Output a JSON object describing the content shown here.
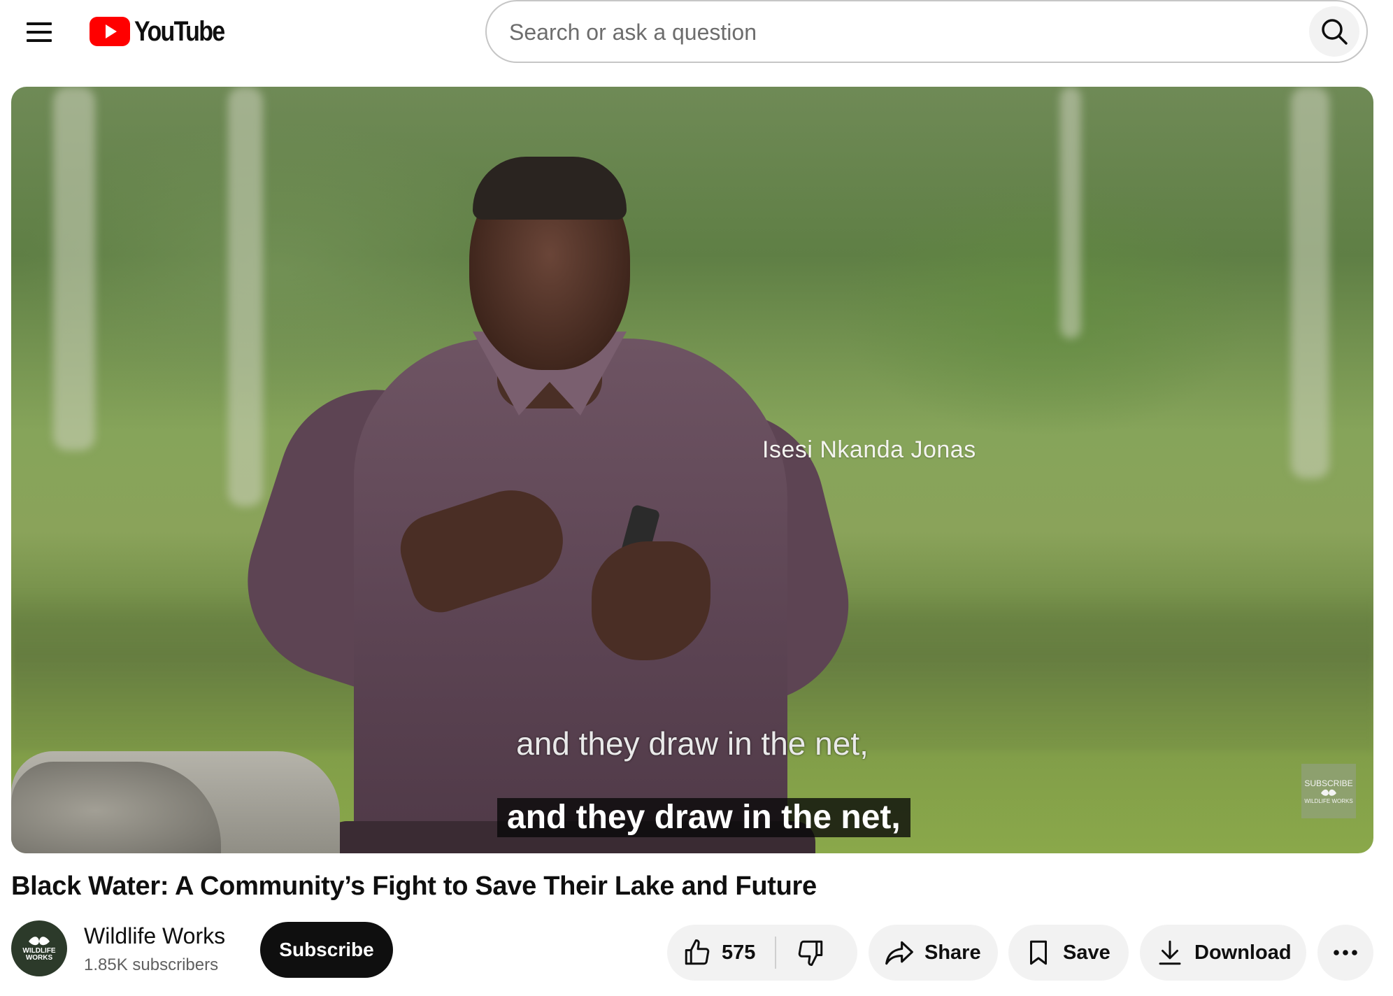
{
  "masthead": {
    "logo_text": "YouTube",
    "search_placeholder": "Search or ask a question"
  },
  "player": {
    "name_overlay": "Isesi Nkanda Jonas",
    "burned_caption": "and they draw in the net,",
    "closed_caption": "and they draw in the net,",
    "watermark_top": "SUBSCRIBE",
    "watermark_bottom": "WILDLIFE WORKS"
  },
  "video": {
    "title": "Black Water: A Community’s Fight to Save Their Lake and Future"
  },
  "channel": {
    "name": "Wildlife Works",
    "subscribers": "1.85K subscribers",
    "avatar_text_1": "WILDLIFE",
    "avatar_text_2": "WORKS",
    "subscribe_label": "Subscribe"
  },
  "actions": {
    "like_count": "575",
    "share_label": "Share",
    "save_label": "Save",
    "download_label": "Download"
  },
  "icons": {
    "menu": "hamburger-menu-icon",
    "logo": "youtube-play-icon",
    "search": "search-icon",
    "like": "thumbs-up-icon",
    "dislike": "thumbs-down-icon",
    "share": "share-arrow-icon",
    "save": "bookmark-icon",
    "download": "download-icon",
    "more": "more-horizontal-icon"
  },
  "colors": {
    "brand_red": "#ff0000",
    "text_primary": "#0f0f0f",
    "text_secondary": "#606060",
    "pill_bg": "#f2f2f2",
    "subscribe_bg": "#0f0f0f"
  }
}
